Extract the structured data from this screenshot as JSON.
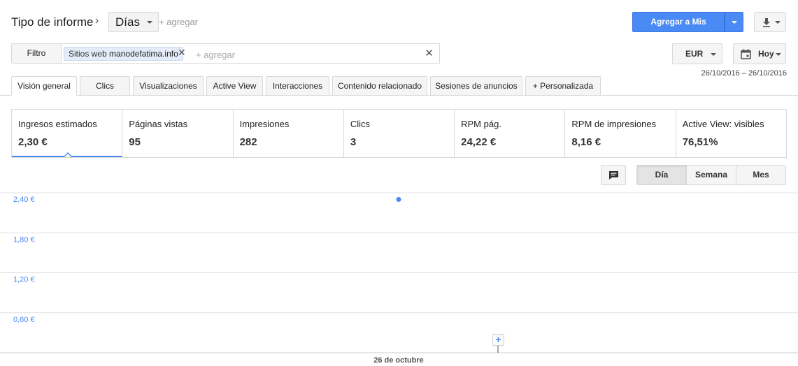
{
  "header": {
    "title": "Tipo de informe",
    "chevron": "›",
    "report_type": "Días",
    "add_label": "+ agregar",
    "add_to_reports": "Agregar a Mis informes"
  },
  "filter": {
    "label": "Filtro",
    "chip_prefix": "Sitios web",
    "chip_value": "manodefatima.info",
    "chip_remove": "✕",
    "add_placeholder": "+ agregar",
    "clear": "✕"
  },
  "controls": {
    "currency": "EUR",
    "date_preset": "Hoy",
    "date_range": "26/10/2016 – 26/10/2016"
  },
  "tabs": [
    {
      "label": "Visión general",
      "active": true
    },
    {
      "label": "Clics"
    },
    {
      "label": "Visualizaciones"
    },
    {
      "label": "Active View"
    },
    {
      "label": "Interacciones"
    },
    {
      "label": "Contenido relacionado"
    },
    {
      "label": "Sesiones de anuncios"
    },
    {
      "label": "+ Personalizada"
    }
  ],
  "metrics": [
    {
      "label": "Ingresos estimados",
      "value": "2,30 €",
      "active": true
    },
    {
      "label": "Páginas vistas",
      "value": "95"
    },
    {
      "label": "Impresiones",
      "value": "282"
    },
    {
      "label": "Clics",
      "value": "3"
    },
    {
      "label": "RPM pág.",
      "value": "24,22 €"
    },
    {
      "label": "RPM de impresiones",
      "value": "8,16 €"
    },
    {
      "label": "Active View: visibles",
      "value": "76,51%"
    }
  ],
  "period": {
    "day": "Día",
    "week": "Semana",
    "month": "Mes",
    "selected": "Día"
  },
  "annotation_add": "+",
  "colors": {
    "accent": "#4a8af4",
    "axis_label": "#4a8af4",
    "grid": "#e0e0e0"
  },
  "chart_data": {
    "type": "line",
    "x": [
      "26 de octubre"
    ],
    "series": [
      {
        "values": [
          2.3
        ]
      }
    ],
    "ytick_labels": [
      "2,40 €",
      "1,80 €",
      "1,20 €",
      "0,60 €"
    ],
    "yticks": [
      2.4,
      1.8,
      1.2,
      0.6
    ],
    "ylim": [
      0,
      2.4
    ],
    "xlabel": "26 de octubre",
    "grid": true
  }
}
